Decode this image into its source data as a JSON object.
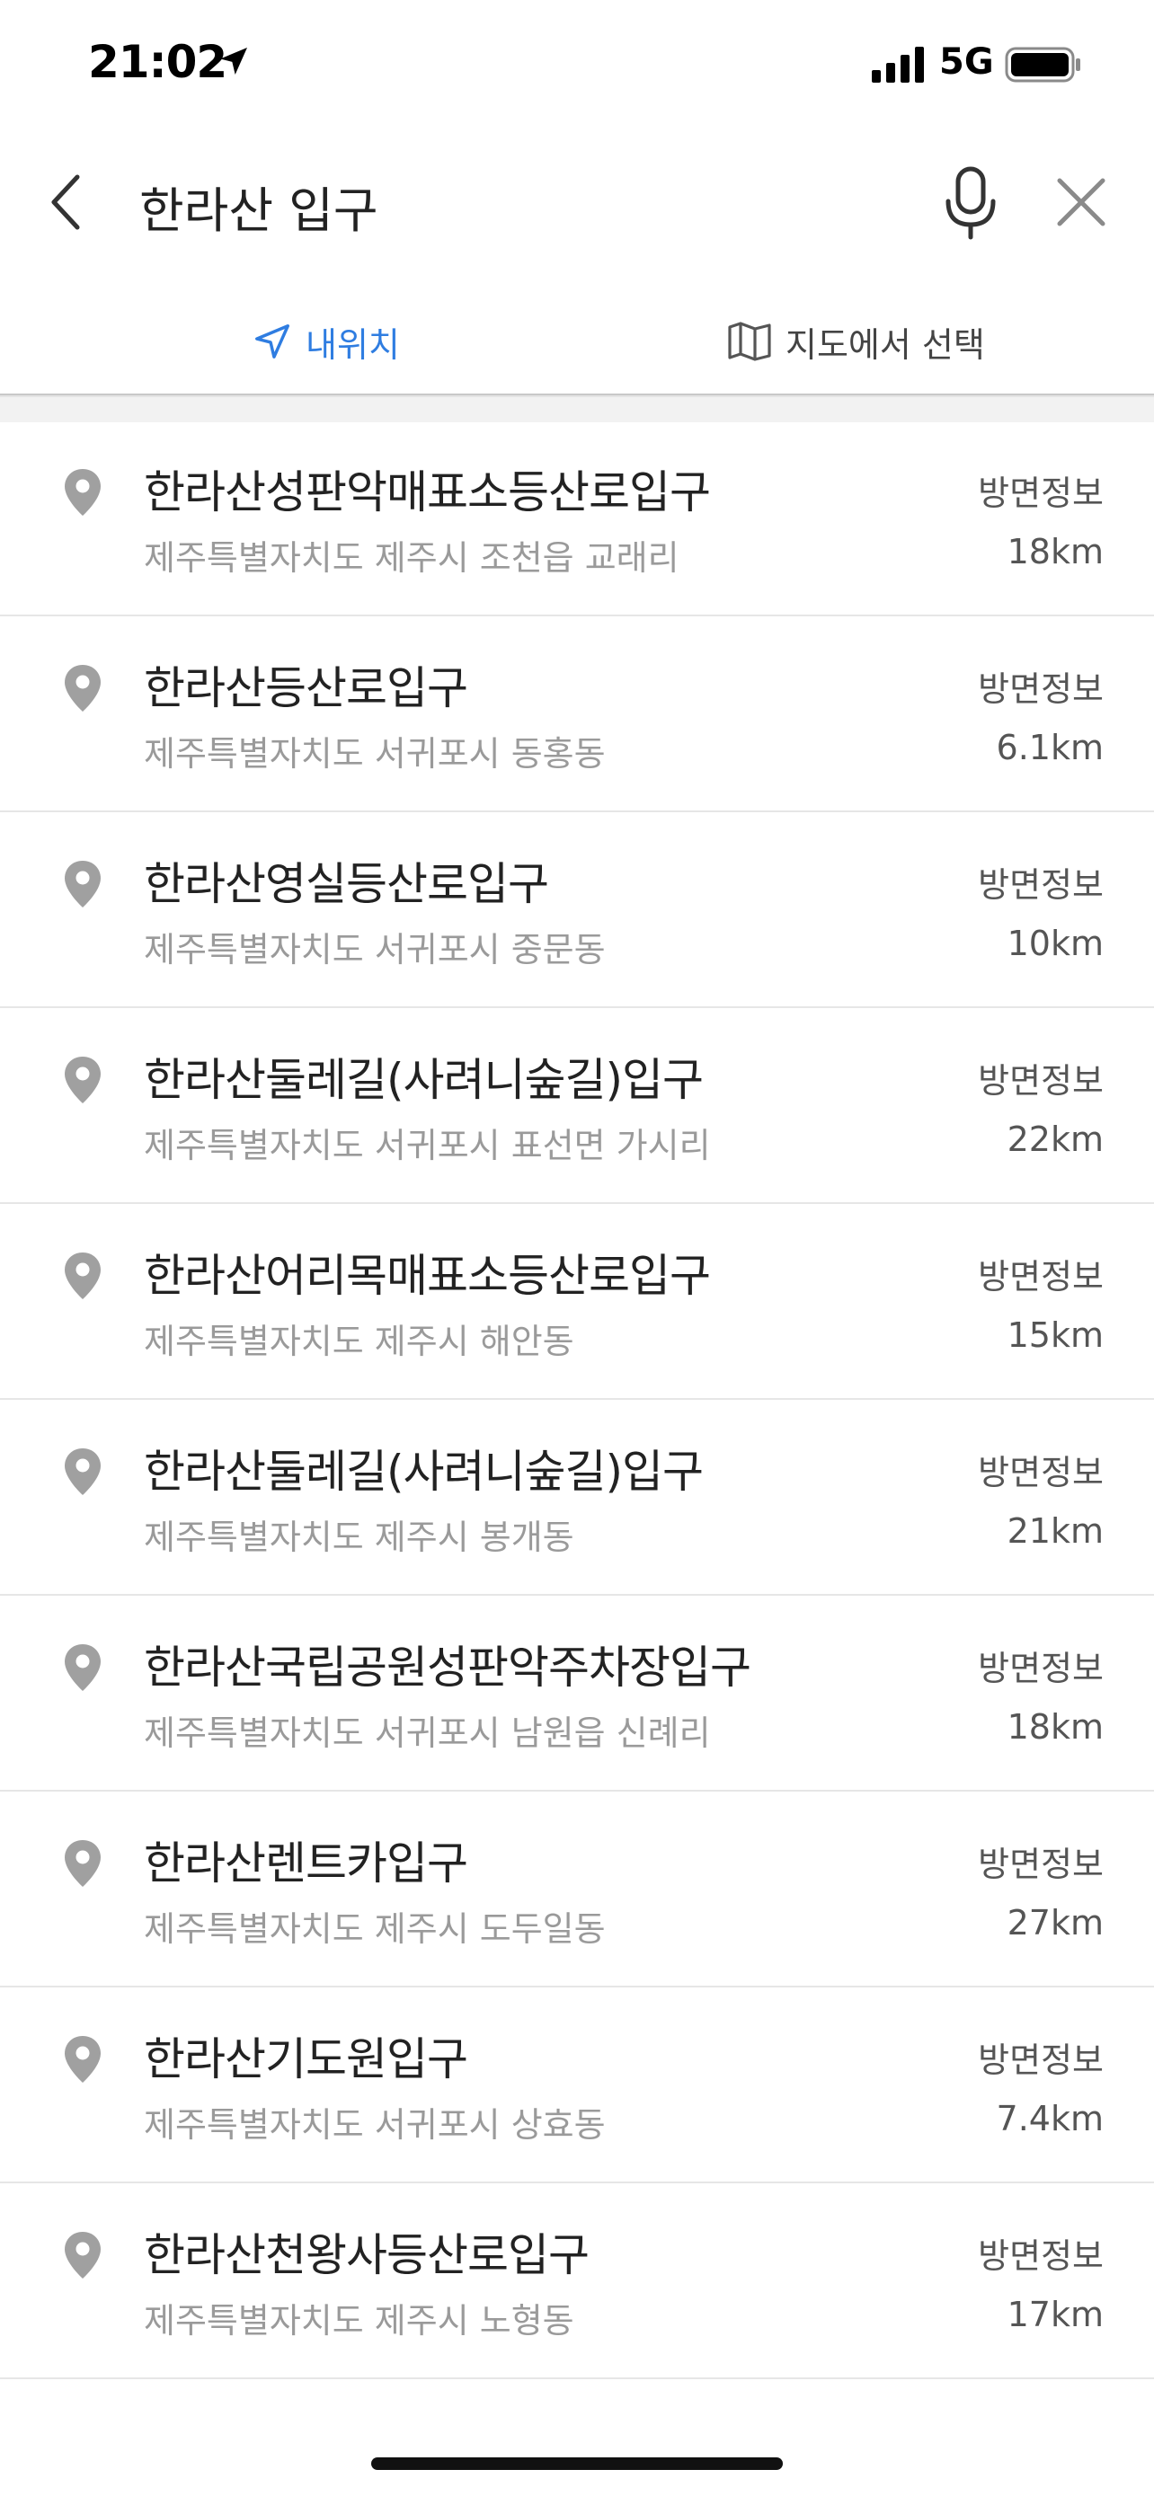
{
  "status_bar": {
    "time": "21:02",
    "network": "5G"
  },
  "search": {
    "query": "한라산 입구"
  },
  "tabs": [
    {
      "label": "내위치",
      "active": true,
      "icon": "navigation-arrow-icon"
    },
    {
      "label": "지도에서 선택",
      "active": false,
      "icon": "map-icon"
    }
  ],
  "results": [
    {
      "name": "한라산성판악매표소등산로입구",
      "address": "제주특별자치도 제주시 조천읍 교래리",
      "direction": "방면정보",
      "distance": "18km"
    },
    {
      "name": "한라산등산로입구",
      "address": "제주특별자치도 서귀포시 동홍동",
      "direction": "방면정보",
      "distance": "6.1km"
    },
    {
      "name": "한라산영실등산로입구",
      "address": "제주특별자치도 서귀포시 중문동",
      "direction": "방면정보",
      "distance": "10km"
    },
    {
      "name": "한라산둘레길(사려니숲길)입구",
      "address": "제주특별자치도 서귀포시 표선면 가시리",
      "direction": "방면정보",
      "distance": "22km"
    },
    {
      "name": "한라산어리목매표소등산로입구",
      "address": "제주특별자치도 제주시 해안동",
      "direction": "방면정보",
      "distance": "15km"
    },
    {
      "name": "한라산둘레길(사려니숲길)입구",
      "address": "제주특별자치도 제주시 봉개동",
      "direction": "방면정보",
      "distance": "21km"
    },
    {
      "name": "한라산국립공원성판악주차장입구",
      "address": "제주특별자치도 서귀포시 남원읍 신례리",
      "direction": "방면정보",
      "distance": "18km"
    },
    {
      "name": "한라산렌트카입구",
      "address": "제주특별자치도 제주시 도두일동",
      "direction": "방면정보",
      "distance": "27km"
    },
    {
      "name": "한라산기도원입구",
      "address": "제주특별자치도 서귀포시 상효동",
      "direction": "방면정보",
      "distance": "7.4km"
    },
    {
      "name": "한라산천왕사등산로입구",
      "address": "제주특별자치도 제주시 노형동",
      "direction": "방면정보",
      "distance": "17km"
    }
  ],
  "colors": {
    "accent": "#2f7de1",
    "pin": "#a0a0a0",
    "secondary_text": "#9a9a9a"
  }
}
